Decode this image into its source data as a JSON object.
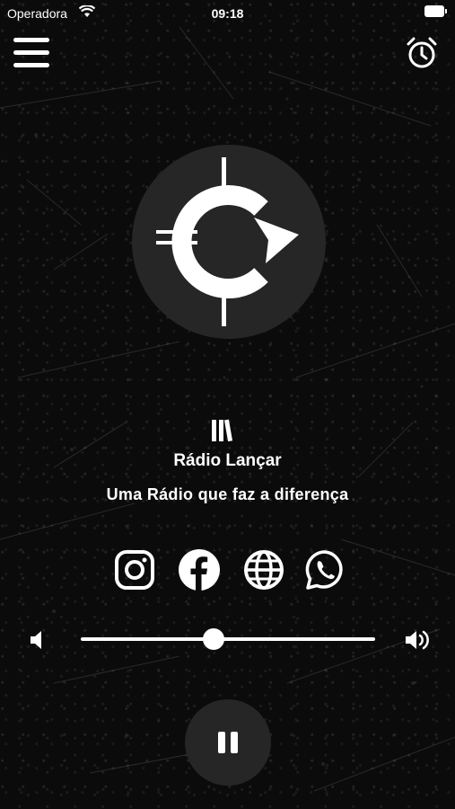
{
  "status_bar": {
    "carrier": "Operadora",
    "time": "09:18"
  },
  "header": {
    "menu_icon": "hamburger-icon",
    "alarm_icon": "alarm-clock-icon"
  },
  "station": {
    "name": "Rádio Lançar",
    "slogan": "Uma Rádio que faz a diferença",
    "logo_icon": "station-logo-icon",
    "equalizer_icon": "equalizer-bars-icon"
  },
  "social": [
    {
      "icon": "instagram-icon"
    },
    {
      "icon": "facebook-icon"
    },
    {
      "icon": "globe-icon"
    },
    {
      "icon": "whatsapp-icon"
    }
  ],
  "volume": {
    "level": 0.45,
    "low_icon": "volume-low-icon",
    "high_icon": "volume-high-icon"
  },
  "player": {
    "state": "playing",
    "icon": "pause-icon"
  },
  "colors": {
    "background": "#0b0b0b",
    "surface": "#262626",
    "foreground": "#ffffff"
  }
}
